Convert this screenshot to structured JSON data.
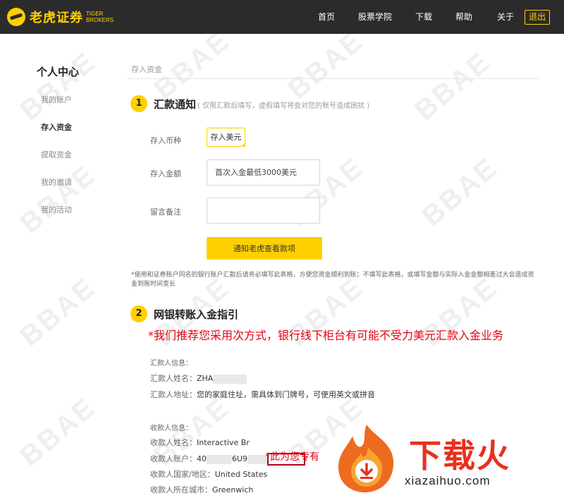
{
  "header": {
    "logo_cn": "老虎证券",
    "logo_en_line1": "TIGER",
    "logo_en_line2": "BROKERS",
    "nav": [
      "首页",
      "股票学院",
      "下载",
      "帮助",
      "关于"
    ],
    "logout_label": "退出"
  },
  "watermark_text": "BBAE",
  "sidebar": {
    "title": "个人中心",
    "items": [
      "我的账户",
      "存入资金",
      "提取资金",
      "我的邀请",
      "我的活动"
    ],
    "active_index": 1
  },
  "breadcrumb": "存入资金",
  "step1": {
    "number": "1",
    "title": "汇款通知",
    "note": "( 仅限汇款后填写，虚假填写将会对您的账号造成困扰 )",
    "currency_label": "存入币种",
    "currency_value": "存入美元",
    "amount_label": "存入金额",
    "amount_placeholder": "首次入金最低3000美元",
    "remark_label": "留言备注",
    "remark_value": "",
    "submit_label": "通知老虎查看款项",
    "warning": "*使用和证券账户同名的银行账户汇款后请务必填写此表格，方便您资金顺利到账；不填写此表格，或填写金额与实际入金金额相差过大会造成资金到账时间变长"
  },
  "step2": {
    "number": "2",
    "title": "网银转账入金指引",
    "recommend_note": "*我们推荐您采用次方式，银行线下柜台有可能不受力美元汇款入金业务",
    "sender_section": "汇款人信息：",
    "sender_name_label": "汇款人姓名：",
    "sender_name_value": "ZHA",
    "sender_addr_label": "汇款人地址：",
    "sender_addr_value": "您的家庭住址，需具体到门牌号，可使用英文或拼音",
    "receiver_section": "收款人信息：",
    "receiver_name_label": "收款人姓名：",
    "receiver_name_value": "Interactive Br",
    "receiver_acct_label": "收款人账户：",
    "receiver_acct_prefix": "40",
    "receiver_acct_mid": "6U9",
    "receiver_acct_note": "*此为您专有",
    "receiver_country_label": "收款人国家/地区：",
    "receiver_country_value": "United States",
    "receiver_city_label": "收款人所在城市：",
    "receiver_city_value": "Greenwich"
  },
  "overlay_logo": {
    "text": "下载火",
    "url": "xiazaihuo.com"
  },
  "colors": {
    "brand_yellow": "#ffd000",
    "topbar": "#2b2b2b",
    "alert_red": "#e60012"
  }
}
